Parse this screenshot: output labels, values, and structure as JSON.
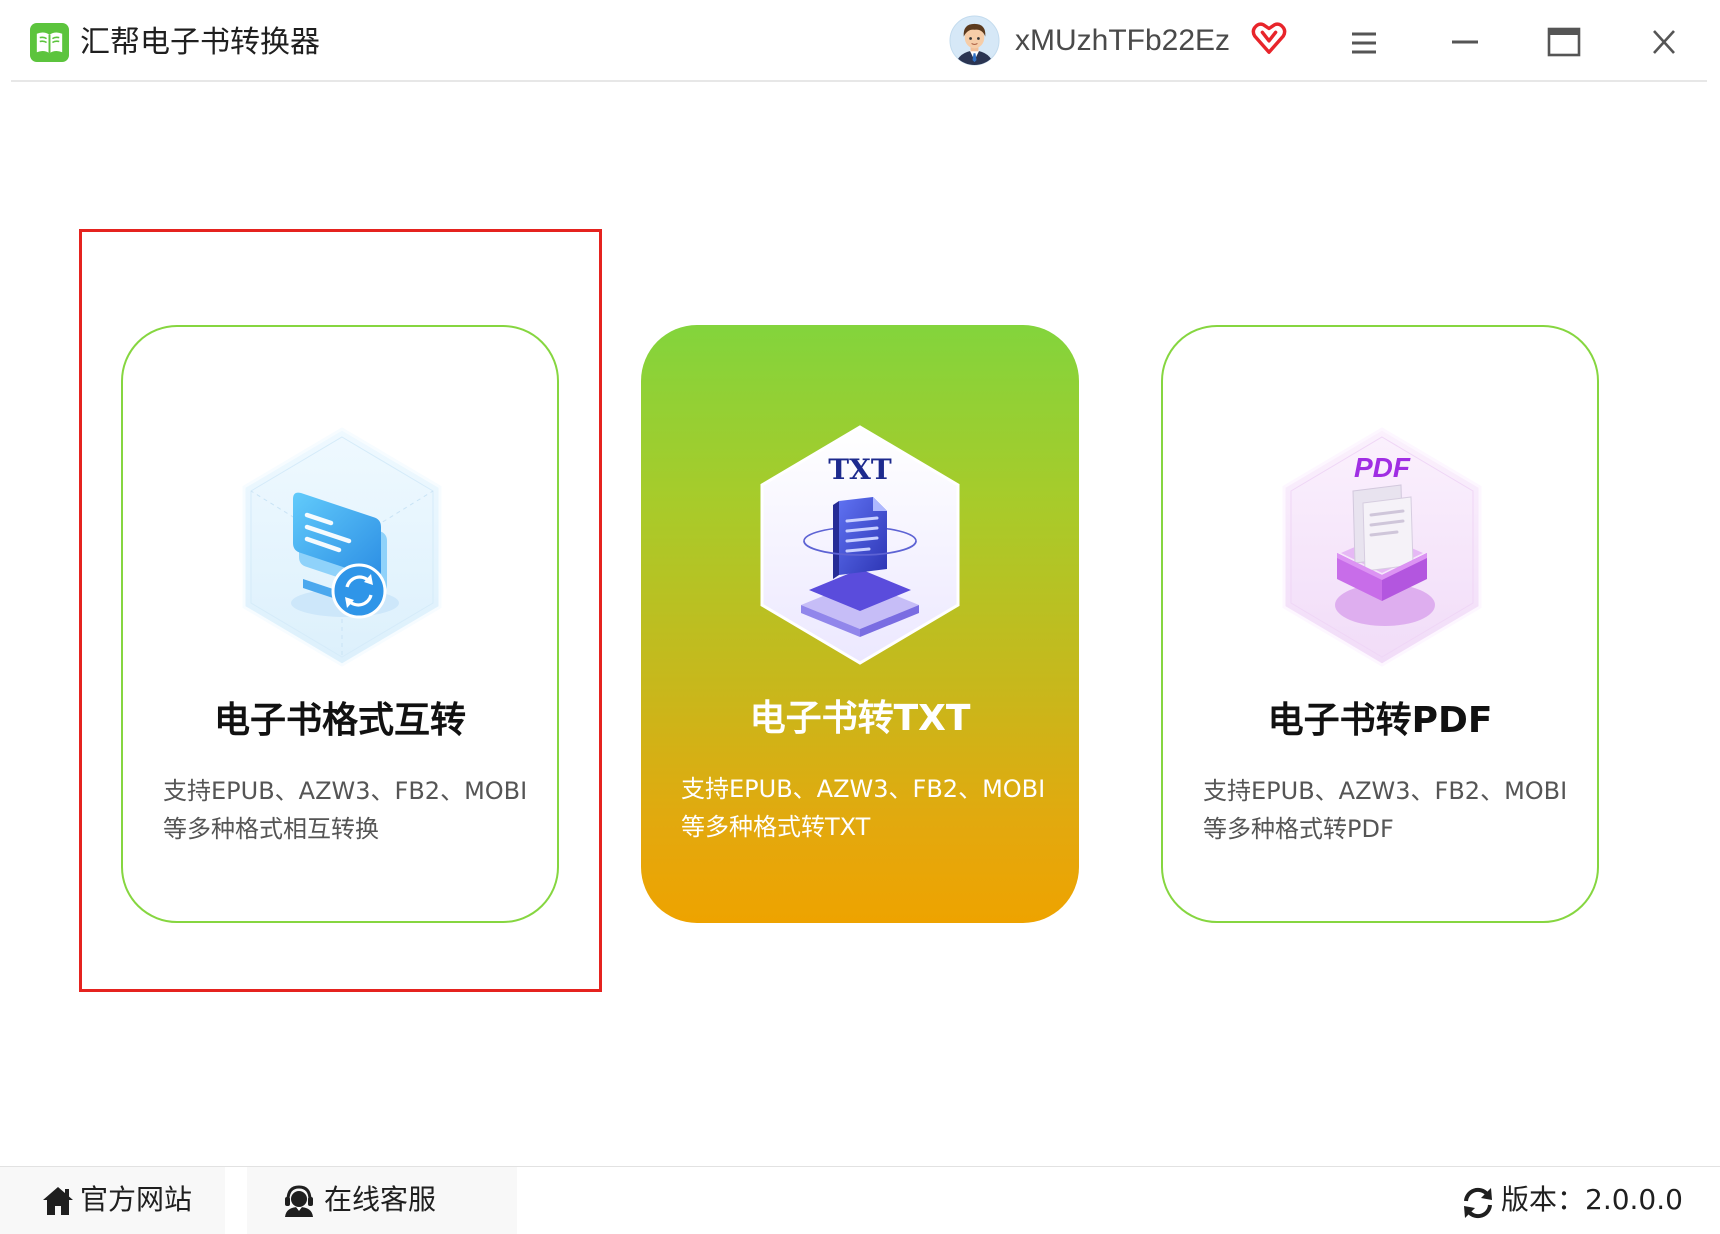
{
  "app": {
    "title": "汇帮电子书转换器",
    "logo_icon": "book-logo-icon"
  },
  "user": {
    "name": "xMUzhTFb22Ez",
    "avatar_icon": "user-avatar-icon",
    "vip_icon": "vip-badge-icon"
  },
  "window_controls": {
    "icons": [
      "menu-icon",
      "minimize-icon",
      "maximize-icon",
      "close-icon"
    ]
  },
  "cards": [
    {
      "title": "电子书格式互转",
      "desc_line1": "支持EPUB、AZW3、FB2、MOBI",
      "desc_line2": "等多种格式相互转换",
      "icon": "format-convert-icon"
    },
    {
      "title": "电子书转TXT",
      "desc_line1": "支持EPUB、AZW3、FB2、MOBI",
      "desc_line2": "等多种格式转TXT",
      "icon": "txt-document-icon",
      "icon_label": "TXT"
    },
    {
      "title": "电子书转PDF",
      "desc_line1": "支持EPUB、AZW3、FB2、MOBI",
      "desc_line2": "等多种格式转PDF",
      "icon": "pdf-tray-icon",
      "icon_label": "PDF"
    }
  ],
  "footer": {
    "website": "官方网站",
    "website_icon": "home-icon",
    "support": "在线客服",
    "support_icon": "customer-service-icon",
    "version": "版本：2.0.0.0",
    "version_icon": "refresh-icon"
  },
  "colors": {
    "card_border": "#86d640",
    "active_card_top": "#83d43c",
    "active_card_bottom": "#eea300",
    "selection_box": "#e5231f",
    "logo_green": "#5cc43d",
    "vip_red": "#e8252b"
  }
}
